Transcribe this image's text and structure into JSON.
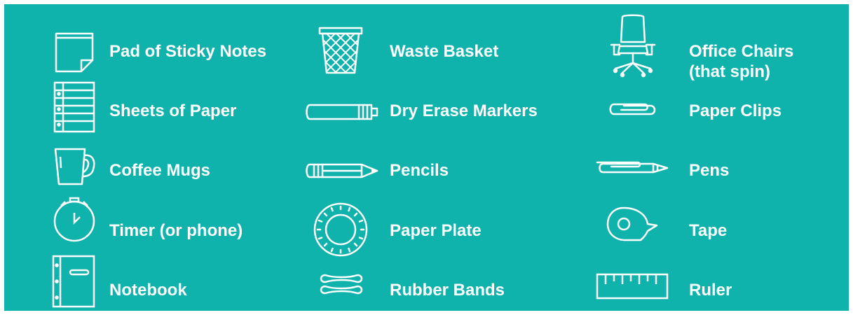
{
  "accent_color": "#0fb3ac",
  "items": [
    {
      "label": "Pad of Sticky Notes",
      "icon": "sticky-notes-icon"
    },
    {
      "label": "Sheets of Paper",
      "icon": "paper-sheets-icon"
    },
    {
      "label": "Coffee Mugs",
      "icon": "coffee-mug-icon"
    },
    {
      "label": "Timer (or phone)",
      "icon": "timer-icon"
    },
    {
      "label": "Notebook",
      "icon": "notebook-icon"
    },
    {
      "label": "Waste Basket",
      "icon": "waste-basket-icon"
    },
    {
      "label": "Dry Erase Markers",
      "icon": "marker-icon"
    },
    {
      "label": "Pencils",
      "icon": "pencil-icon"
    },
    {
      "label": "Paper Plate",
      "icon": "paper-plate-icon"
    },
    {
      "label": "Rubber Bands",
      "icon": "rubber-bands-icon"
    },
    {
      "label": "Office Chairs",
      "label2": "(that spin)",
      "icon": "office-chair-icon"
    },
    {
      "label": "Paper Clips",
      "icon": "paper-clip-icon"
    },
    {
      "label": "Pens",
      "icon": "pen-icon"
    },
    {
      "label": "Tape",
      "icon": "tape-icon"
    },
    {
      "label": "Ruler",
      "icon": "ruler-icon"
    }
  ]
}
